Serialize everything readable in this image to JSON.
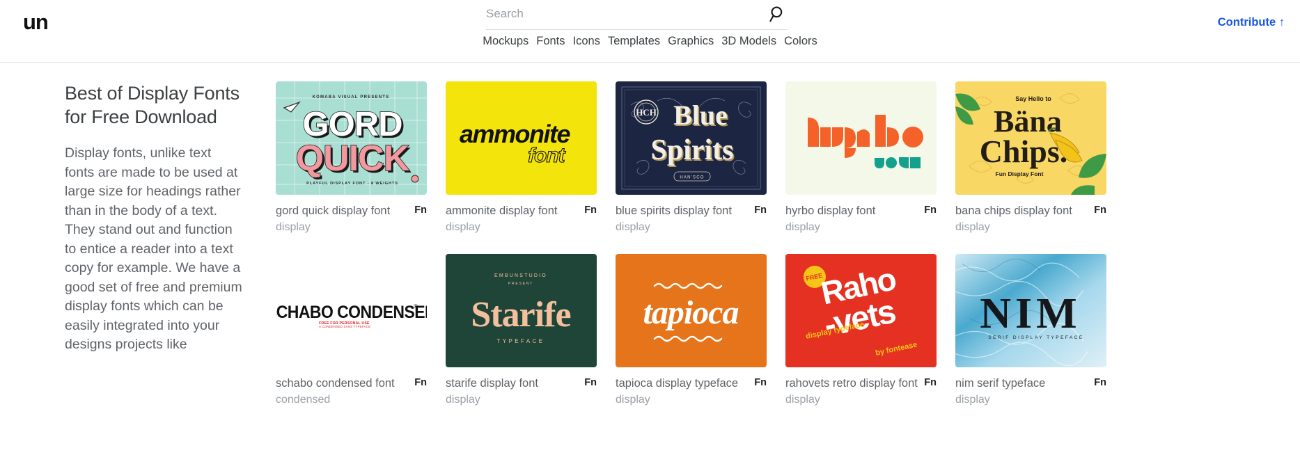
{
  "header": {
    "logo": "un",
    "search": {
      "placeholder": "Search",
      "value": "",
      "icon": "search-icon"
    },
    "nav": [
      "Mockups",
      "Fonts",
      "Icons",
      "Templates",
      "Graphics",
      "3D Models",
      "Colors"
    ],
    "contribute": "Contribute ↑",
    "contribute_color": "#1a56e8"
  },
  "sidebar": {
    "title": "Best of Display Fonts for Free Download",
    "body": "Display fonts, unlike text fonts are made to be used at large size for headings rather than in the body of a text. They stand out and function to entice a reader into a text copy for example. We have a good set of free and premium display fonts which can be easily integrated into your designs projects like"
  },
  "badge_label": "Fn",
  "cards": [
    {
      "title": "gord quick display font",
      "tag": "display",
      "bg": "#a9ded3",
      "art": {
        "kicker": "KOMABA VISUAL PRESENTS",
        "line1": "GORD",
        "line2": "QUICK",
        "footer": "PLAYFUL DISPLAY FONT - 8 WEIGHTS",
        "line1_color": "#ffffff",
        "line2_color": "#f2999f"
      }
    },
    {
      "title": "ammonite display font",
      "tag": "display",
      "bg": "#f3e40b",
      "art": {
        "line1": "ammonite",
        "line2": "font",
        "ink": "#111111"
      }
    },
    {
      "title": "blue spirits display font",
      "tag": "display",
      "bg": "#1c2541",
      "art": {
        "monogram": "HCH",
        "line1": "Blue",
        "line2": "Spirits",
        "footer": "HAN'SCO",
        "ink": "#f2efe6",
        "accent": "#b79a55"
      }
    },
    {
      "title": "hyrbo display font",
      "tag": "display",
      "bg": "#f3f8e9",
      "art": {
        "word": "hyrbo",
        "ink": "#f4622a",
        "accent": "#13a08c"
      }
    },
    {
      "title": "bana chips display font",
      "tag": "display",
      "bg": "#f8d764",
      "art": {
        "kicker": "Say Hello to",
        "line1": "Bäna",
        "line2": "Chips.",
        "footer": "Fun Display Font",
        "ink": "#211d18",
        "leaf": "#3f9a45",
        "banana": "#f2c319"
      }
    },
    {
      "title": "schabo condensed font",
      "tag": "condensed",
      "bg": "#ffffff",
      "art": {
        "word": "SCHABO CONDENSED",
        "mark": "®",
        "sub": "FREE FOR PERSONAL USE",
        "ink": "#111111",
        "accent": "#d81f26"
      }
    },
    {
      "title": "starife display font",
      "tag": "display",
      "bg": "#1f4539",
      "art": {
        "kicker": "EMBUNSTUDIO",
        "kicker2": "PRESENT",
        "word": "Starife",
        "footer": "TYPEFACE",
        "ink": "#f3bf9d"
      }
    },
    {
      "title": "tapioca display typeface",
      "tag": "display",
      "bg": "#e5741b",
      "art": {
        "word": "tapioca",
        "ink": "#ffffff"
      }
    },
    {
      "title": "rahovets retro display font",
      "tag": "display",
      "bg": "#e53122",
      "art": {
        "badge": "FREE",
        "line1": "Raho",
        "line2": "-vets",
        "sub1": "display typeface",
        "sub2": "by fontease",
        "ink": "#ffffff",
        "accent": "#f5c518"
      }
    },
    {
      "title": "nim serif typeface",
      "tag": "display",
      "bg": "#9fd4e8",
      "art": {
        "word": "NIM",
        "footer": "SERIF DISPLAY TYPEFACE",
        "ink": "#15171a"
      }
    }
  ]
}
